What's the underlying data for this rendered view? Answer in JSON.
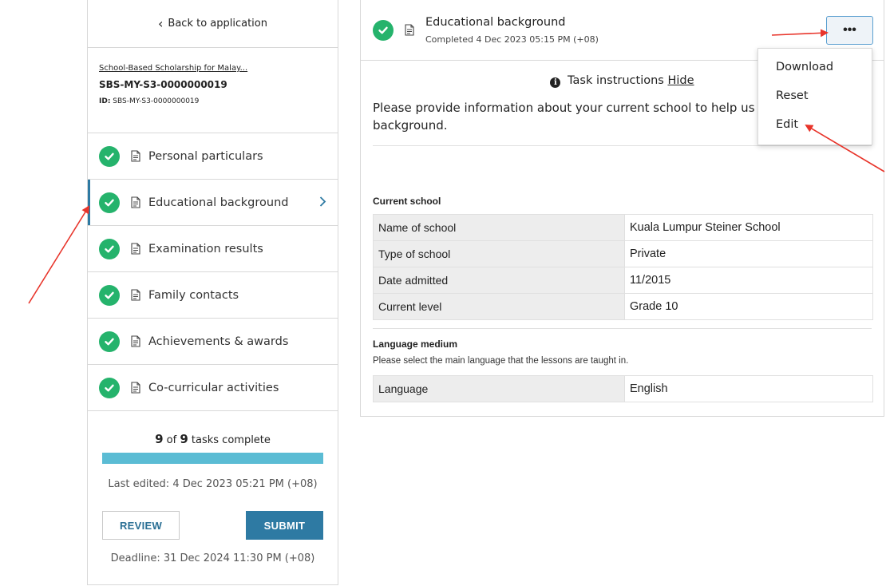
{
  "sidebar": {
    "back_label": "Back to application",
    "application": {
      "name": "School-Based Scholarship for Malay...",
      "code": "SBS-MY-S3-0000000019",
      "id_label": "ID:",
      "id_value": "SBS-MY-S3-0000000019"
    },
    "tasks": [
      {
        "label": "Personal particulars",
        "icon": "check-circle-icon",
        "complete": true
      },
      {
        "label": "Educational background",
        "icon": "check-circle-icon",
        "complete": true,
        "active": true
      },
      {
        "label": "Examination results",
        "icon": "check-circle-icon",
        "complete": true
      },
      {
        "label": "Family contacts",
        "icon": "check-circle-icon",
        "complete": true
      },
      {
        "label": "Achievements & awards",
        "icon": "check-circle-icon",
        "complete": true
      },
      {
        "label": "Co-curricular activities",
        "icon": "check-circle-icon",
        "complete": true
      }
    ],
    "progress": {
      "done": "9",
      "of": "of",
      "total": "9",
      "suffix": "tasks complete",
      "fraction": 1.0
    },
    "last_edited": "Last edited: 4 Dec 2023 05:21 PM (+08)",
    "review_label": "REVIEW",
    "submit_label": "SUBMIT",
    "deadline": "Deadline: 31 Dec 2024 11:30 PM (+08)"
  },
  "panel": {
    "title": "Educational background",
    "subtitle": "Completed 4 Dec 2023 05:15 PM (+08)",
    "more_label": "•••",
    "instructions_label": "Task instructions",
    "hide_label": "Hide",
    "instructions_text": "Please provide information about your current school to help us underst",
    "instructions_text2": "background.",
    "current_school": {
      "title": "Current school",
      "rows": [
        {
          "key": "Name of school",
          "value": "Kuala Lumpur Steiner School"
        },
        {
          "key": "Type of school",
          "value": "Private"
        },
        {
          "key": "Date admitted",
          "value": "11/2015"
        },
        {
          "key": "Current level",
          "value": "Grade 10"
        }
      ]
    },
    "language_medium": {
      "title": "Language medium",
      "description": "Please select the main language that the lessons are taught in.",
      "rows": [
        {
          "key": "Language",
          "value": "English"
        }
      ]
    }
  },
  "menu": {
    "items": [
      "Download",
      "Reset",
      "Edit"
    ]
  },
  "colors": {
    "accent": "#2e7aa3",
    "success": "#25b36c",
    "progress": "#5bbcd4",
    "annotation": "#e8342a"
  }
}
